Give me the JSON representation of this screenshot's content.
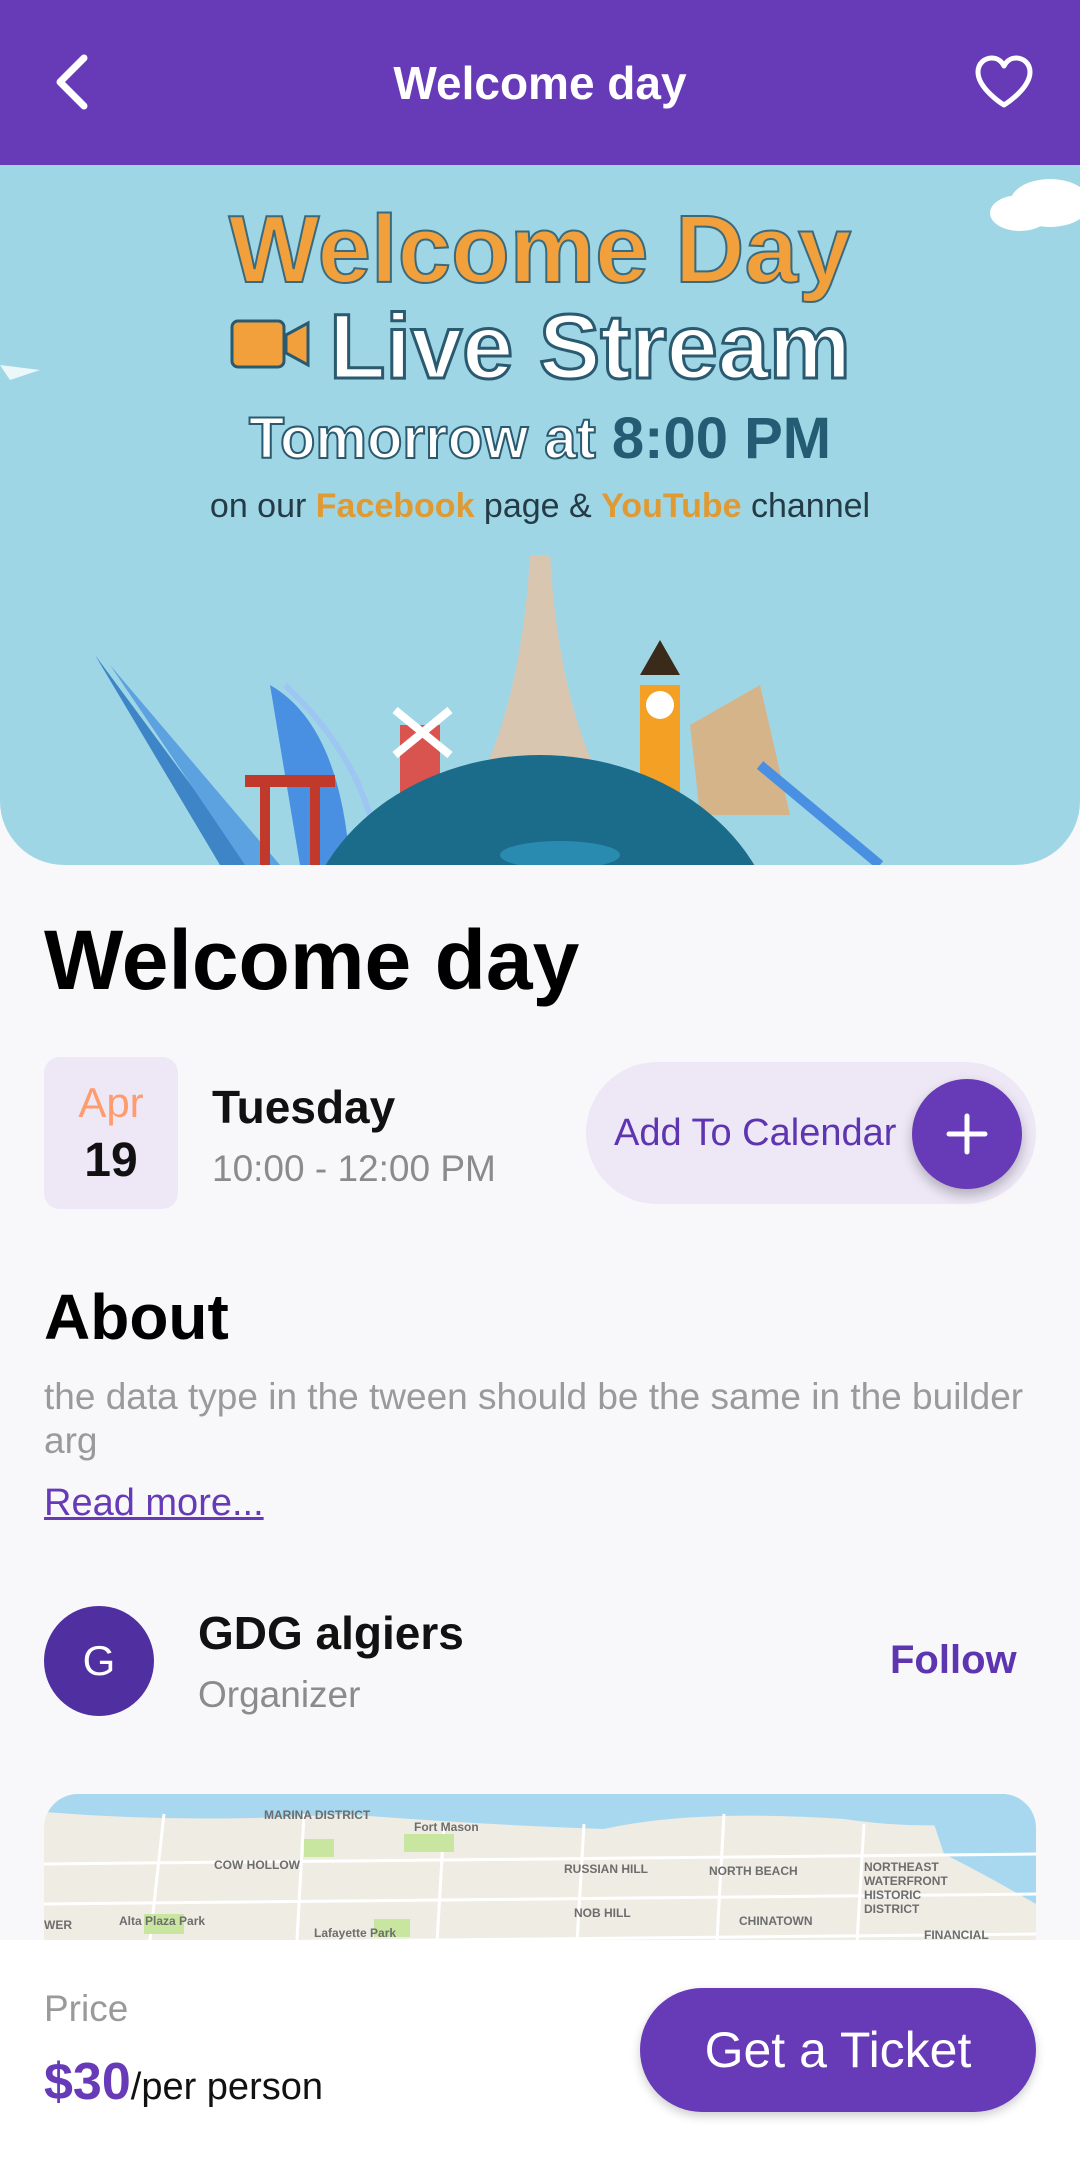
{
  "colors": {
    "primary": "#673ab7",
    "accent_light": "#ede7f6",
    "month": "#ff9c6e"
  },
  "header": {
    "title": "Welcome day",
    "back_icon": "chevron-left-icon",
    "favorite_icon": "heart-icon"
  },
  "banner": {
    "line1": "Welcome Day",
    "line2": "Live Stream",
    "line3_prefix": "Tomorrow at ",
    "line3_time": "8:00 PM",
    "line4_a": "on our ",
    "line4_b": "Facebook",
    "line4_c": " page & ",
    "line4_d": "YouTube",
    "line4_e": " channel"
  },
  "event": {
    "title": "Welcome day",
    "month": "Apr",
    "day": "19",
    "weekday": "Tuesday",
    "time_range": "10:00 - 12:00 PM",
    "add_calendar_label": "Add To Calendar"
  },
  "about": {
    "heading": "About",
    "text": "the data type in the tween should be the same in the builder arg",
    "read_more": "Read more..."
  },
  "organizer": {
    "initial": "G",
    "name": "GDG algiers",
    "role": "Organizer",
    "follow_label": "Follow"
  },
  "map": {
    "labels": [
      "MARINA DISTRICT",
      "Fort Mason",
      "COW HOLLOW",
      "RUSSIAN HILL",
      "NORTH BEACH",
      "NORTHEAST WATERFRONT HISTORIC DISTRICT",
      "NOB HILL",
      "CHINATOWN",
      "FINANCIAL",
      "Alta Plaza Park",
      "Lafayette Park",
      "WER"
    ]
  },
  "footer": {
    "price_label": "Price",
    "price_value": "$30",
    "price_unit": "/per person",
    "ticket_label": "Get a Ticket"
  }
}
